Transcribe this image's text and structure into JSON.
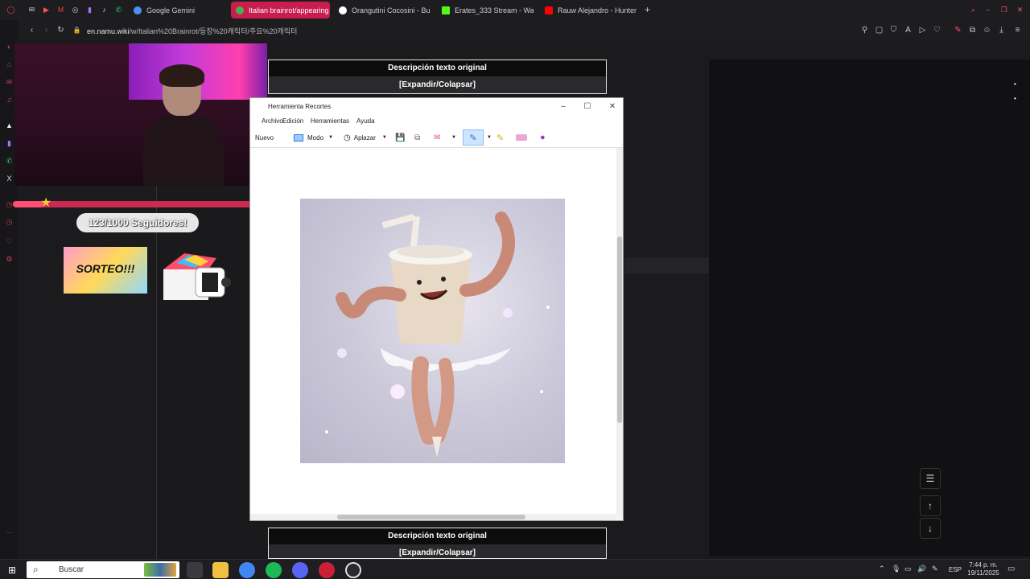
{
  "browser": {
    "tabs": [
      {
        "label": "Google Gemini",
        "color": "#4f8ef7"
      },
      {
        "label": "Italian brainrot/appearing",
        "color": "#4caf50",
        "active": true
      },
      {
        "label": "Orangutini Cocosini - Bu",
        "color": "#ffffff"
      },
      {
        "label": "Erates_333 Stream - Wat",
        "color": "#53fc18"
      },
      {
        "label": "Rauw Alejandro - Hunter",
        "color": "#ff0000"
      }
    ],
    "url_host": "en.namu.wiki",
    "url_path": "/w/Italian%20Brainrot/등장%20캐릭터/주요%20캐릭터"
  },
  "page": {
    "collapse_title": "Descripción texto original",
    "collapse_toggle": "[Expandir/Colapsar]"
  },
  "stream": {
    "followers": "123/1000 Seguidores!",
    "followers_progress": 0.123,
    "sorteo": "SORTEO!!!"
  },
  "snipping_tool": {
    "title": "Herramienta Recortes",
    "menu": [
      "Archivo",
      "Edición",
      "Herramientas",
      "Ayuda"
    ],
    "tools": {
      "new": "Nuevo",
      "mode": "Modo",
      "delay": "Aplazar"
    }
  },
  "taskbar": {
    "search_placeholder": "Buscar",
    "language": "ESP",
    "time": "7:44 p. m.",
    "date": "19/11/2025"
  }
}
